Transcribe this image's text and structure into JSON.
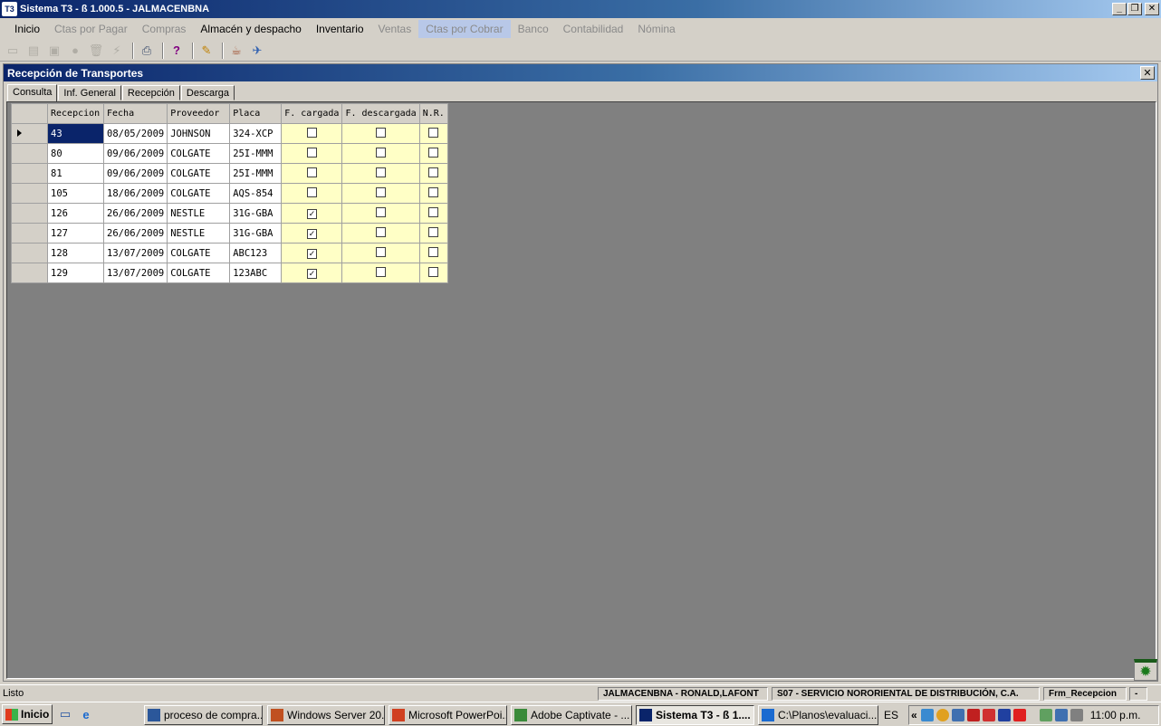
{
  "window": {
    "logo": "T3",
    "title": "Sistema T3 - ß 1.000.5 - JALMACENBNA"
  },
  "menu": [
    {
      "label": "Inicio",
      "enabled": true
    },
    {
      "label": "Ctas por Pagar",
      "enabled": false
    },
    {
      "label": "Compras",
      "enabled": false
    },
    {
      "label": "Almacén y despacho",
      "enabled": true
    },
    {
      "label": "Inventario",
      "enabled": true
    },
    {
      "label": "Ventas",
      "enabled": false
    },
    {
      "label": "Ctas por Cobrar",
      "enabled": false,
      "highlighted": true
    },
    {
      "label": "Banco",
      "enabled": false
    },
    {
      "label": "Contabilidad",
      "enabled": false
    },
    {
      "label": "Nómina",
      "enabled": false
    }
  ],
  "toolbar_icons": [
    "new-icon",
    "open-icon",
    "save-icon",
    "record-icon",
    "delete-icon",
    "lightning-icon",
    "print-icon",
    "help-icon",
    "broom-icon",
    "cup-icon",
    "rocket-icon"
  ],
  "child": {
    "title": "Recepción de Transportes",
    "close_label": "✕",
    "tabs": [
      "Consulta",
      "Inf. General",
      "Recepción",
      "Descarga"
    ],
    "grid": {
      "columns": [
        "Recepcion",
        "Fecha",
        "Proveedor",
        "Placa",
        "F. cargada",
        "F. descargada",
        "N.R."
      ],
      "rows": [
        {
          "recepcion": "43",
          "fecha": "08/05/2009",
          "proveedor": "JOHNSON",
          "placa": "324-XCP",
          "cargada": false,
          "descargada": false,
          "nr": false,
          "current": true
        },
        {
          "recepcion": "80",
          "fecha": "09/06/2009",
          "proveedor": "COLGATE",
          "placa": "25I-MMM",
          "cargada": false,
          "descargada": false,
          "nr": false
        },
        {
          "recepcion": "81",
          "fecha": "09/06/2009",
          "proveedor": "COLGATE",
          "placa": "25I-MMM",
          "cargada": false,
          "descargada": false,
          "nr": false
        },
        {
          "recepcion": "105",
          "fecha": "18/06/2009",
          "proveedor": "COLGATE",
          "placa": "AQS-854",
          "cargada": false,
          "descargada": false,
          "nr": false
        },
        {
          "recepcion": "126",
          "fecha": "26/06/2009",
          "proveedor": "NESTLE",
          "placa": "31G-GBA",
          "cargada": true,
          "descargada": false,
          "nr": false
        },
        {
          "recepcion": "127",
          "fecha": "26/06/2009",
          "proveedor": "NESTLE",
          "placa": "31G-GBA",
          "cargada": true,
          "descargada": false,
          "nr": false
        },
        {
          "recepcion": "128",
          "fecha": "13/07/2009",
          "proveedor": "COLGATE",
          "placa": "ABC123",
          "cargada": true,
          "descargada": false,
          "nr": false
        },
        {
          "recepcion": "129",
          "fecha": "13/07/2009",
          "proveedor": "COLGATE",
          "placa": "123ABC",
          "cargada": true,
          "descargada": false,
          "nr": false
        }
      ]
    }
  },
  "status": {
    "text": "Listo",
    "user": "JALMACENBNA - RONALD,LAFONT",
    "company": "S07 - SERVICIO NORORIENTAL DE DISTRIBUCIÓN, C.A.",
    "form": "Frm_Recepcion",
    "extra": "-"
  },
  "taskbar": {
    "start": "Inicio",
    "tasks": [
      {
        "label": "proceso de compra...",
        "icon_color": "#2b579a"
      },
      {
        "label": "Windows Server 20...",
        "icon_color": "#c05020"
      },
      {
        "label": "Microsoft PowerPoi...",
        "icon_color": "#d04020"
      },
      {
        "label": "Adobe Captivate - ...",
        "icon_color": "#3a8a3a"
      },
      {
        "label": "Sistema T3 - ß 1....",
        "icon_color": "#0a246a",
        "active": true
      },
      {
        "label": "C:\\Planos\\evaluaci...",
        "icon_color": "#1a6ad0"
      }
    ],
    "lang": "ES",
    "clock": "11:00 p.m."
  }
}
